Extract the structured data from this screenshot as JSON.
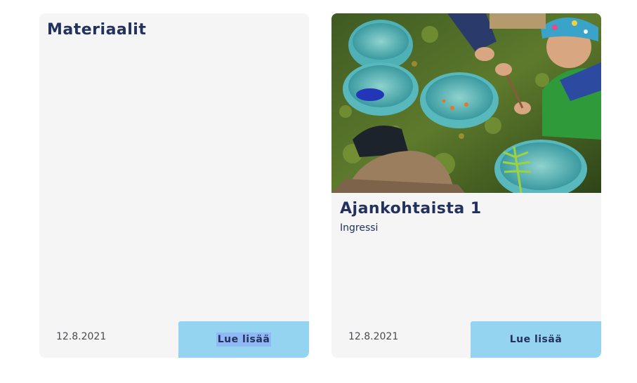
{
  "cards": [
    {
      "title": "Materiaalit",
      "date": "12.8.2021",
      "button_label": "Lue lisää"
    },
    {
      "title": "Ajankohtaista 1",
      "ingress": "Ingressi",
      "date": "12.8.2021",
      "button_label": "Lue lisää"
    }
  ]
}
